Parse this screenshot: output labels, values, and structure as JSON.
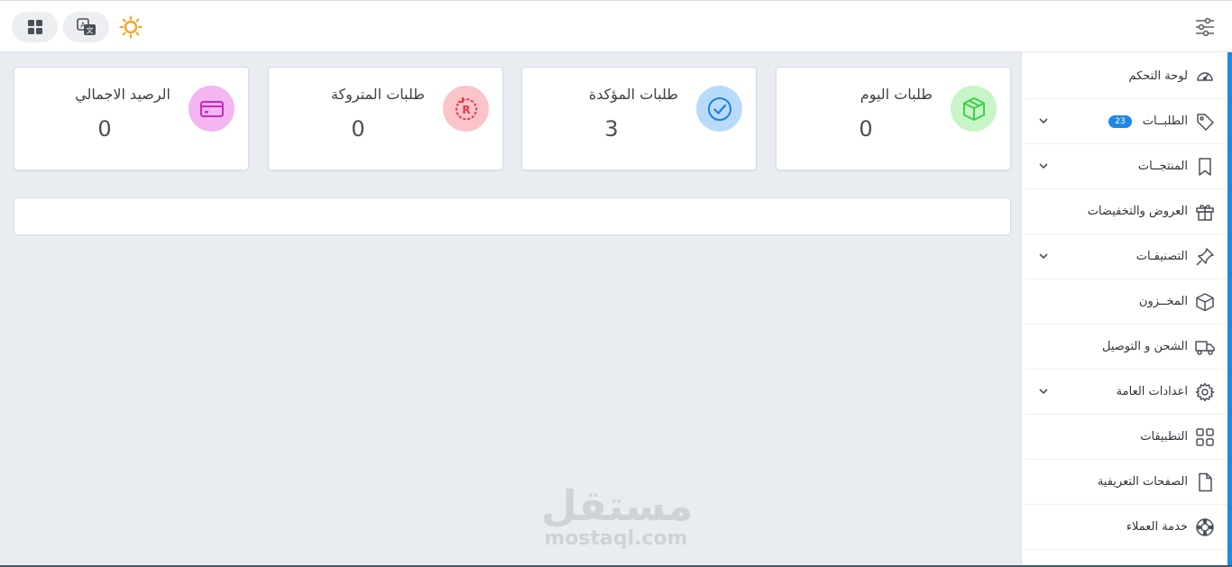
{
  "sidebar": {
    "items": [
      {
        "label": "لوحة التحكم",
        "icon": "speedometer-icon"
      },
      {
        "label": "الطلبــات",
        "icon": "tag-icon",
        "badge": "23",
        "expandable": true
      },
      {
        "label": "المنتجــات",
        "icon": "bookmark-icon",
        "expandable": true
      },
      {
        "label": "العروض والتخفيضات",
        "icon": "gift-icon"
      },
      {
        "label": "التصنيفـات",
        "icon": "pin-icon",
        "expandable": true
      },
      {
        "label": "المخــزون",
        "icon": "box-icon"
      },
      {
        "label": "الشحن و التوصيل",
        "icon": "truck-icon"
      },
      {
        "label": "اعدادات العامة",
        "icon": "gear-icon",
        "expandable": true
      },
      {
        "label": "التطبيقات",
        "icon": "apps-grid-icon"
      },
      {
        "label": "الصفحات التعريفية",
        "icon": "document-icon"
      },
      {
        "label": "خدمة العملاء",
        "icon": "lifebuoy-icon"
      }
    ]
  },
  "stats": [
    {
      "title": "طلبات اليوم",
      "value": "0",
      "icon": "package-icon",
      "color": "#c8f5c8",
      "stroke": "#3fcf4a"
    },
    {
      "title": "طلبات المؤكدة",
      "value": "3",
      "icon": "check-circle-icon",
      "color": "#b9dbfb",
      "stroke": "#1e7fe0"
    },
    {
      "title": "طلبات المتروكة",
      "value": "0",
      "icon": "return-icon",
      "color": "#fbc4c9",
      "stroke": "#e53945"
    },
    {
      "title": "الرصيد الاجمالي",
      "value": "0",
      "icon": "credit-card-icon",
      "color": "#f3b6f0",
      "stroke": "#c928c0"
    }
  ],
  "watermark": {
    "arabic": "مستقل",
    "latin": "mostaql.com"
  },
  "colors": {
    "accent": "#1e88e5",
    "sun": "#f5a623"
  }
}
